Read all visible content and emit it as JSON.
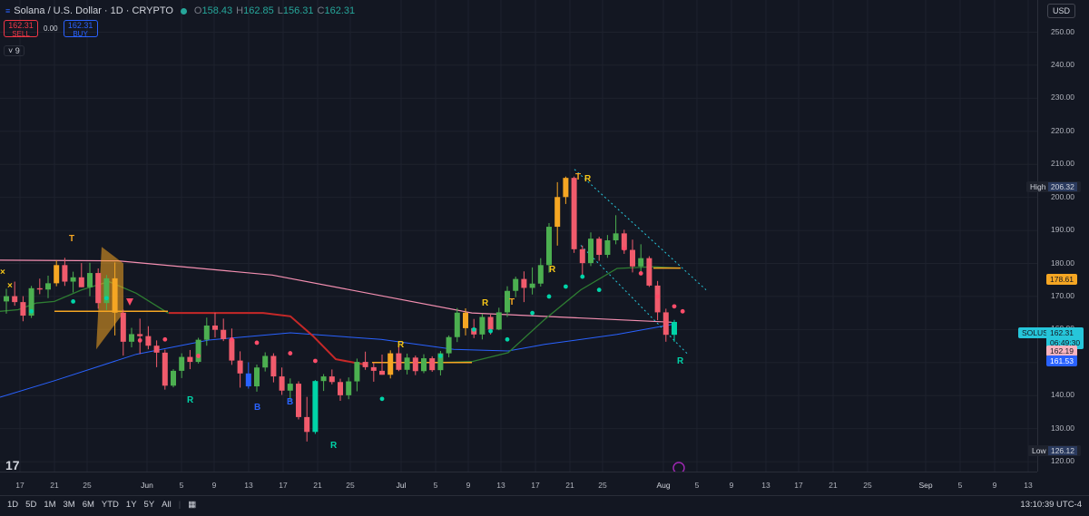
{
  "header": {
    "symbol_title": "Solana / U.S. Dollar · 1D · CRYPTO",
    "ohlc": {
      "o_label": "O",
      "o": "158.43",
      "h_label": "H",
      "h": "162.85",
      "l_label": "L",
      "l": "156.31",
      "c_label": "C",
      "c": "162.31"
    }
  },
  "trade": {
    "sell_price": "162.31",
    "sell_label": "SELL",
    "spread": "0.00",
    "buy_price": "162.31",
    "buy_label": "BUY"
  },
  "indicator_toggle": "˅ 9",
  "currency": "USD",
  "price_scale": [
    "250.00",
    "240.00",
    "230.00",
    "220.00",
    "210.00",
    "200.00",
    "190.00",
    "180.00",
    "170.00",
    "160.00",
    "150.00",
    "140.00",
    "130.00",
    "120.00"
  ],
  "tags": {
    "high_label": "High",
    "high": "206.32",
    "level": "178.61",
    "symbol": "SOLUSD",
    "last": "162.31",
    "countdown": "06:49:30",
    "red_ma": "162.19",
    "blue_ma": "161.53",
    "low_label": "Low",
    "low": "126.12"
  },
  "time_axis": [
    "17",
    "21",
    "25",
    "Jun",
    "5",
    "9",
    "13",
    "17",
    "21",
    "25",
    "Jul",
    "5",
    "9",
    "13",
    "17",
    "21",
    "25",
    "Aug",
    "5",
    "9",
    "13",
    "17",
    "21",
    "25",
    "Sep",
    "5",
    "9",
    "13"
  ],
  "range_buttons": [
    "1D",
    "5D",
    "1M",
    "3M",
    "6M",
    "YTD",
    "1Y",
    "5Y",
    "All"
  ],
  "clock": "13:10:39 UTC-4",
  "logo": "17",
  "chart_data": {
    "type": "candlestick",
    "ylim": [
      117,
      257
    ],
    "colors": {
      "up": "#4caf50",
      "down": "#f15b6c",
      "strong_up": "#00d4a8",
      "strong_down": "#ff4d6a",
      "neutral": "#9e9e6e",
      "signal": "#f5a623",
      "yellow": "#f5c518"
    },
    "candles": [
      [
        168.5,
        172.3,
        164.8,
        170.1
      ],
      [
        170.1,
        174.5,
        167.2,
        168.3
      ],
      [
        168.3,
        170.1,
        162.5,
        164.2
      ],
      [
        164.2,
        173.2,
        163.5,
        172.5
      ],
      [
        172.5,
        175.4,
        170.7,
        172.1
      ],
      [
        172.1,
        176.3,
        169.5,
        174.0
      ],
      [
        174.0,
        181.0,
        173.1,
        179.5
      ],
      [
        179.5,
        181.7,
        173.2,
        174.5
      ],
      [
        174.5,
        177.5,
        171.2,
        175.8
      ],
      [
        175.8,
        180.1,
        172.8,
        172.8
      ],
      [
        172.8,
        180.2,
        170.1,
        177.1
      ],
      [
        177.1,
        178.5,
        166.3,
        168.0
      ],
      [
        168.0,
        176.5,
        165.9,
        175.5
      ],
      [
        175.5,
        180.3,
        158.2,
        165.1
      ],
      [
        165.1,
        166.0,
        152.1,
        156.3
      ],
      [
        156.3,
        160.5,
        154.6,
        158.6
      ],
      [
        158.6,
        163.3,
        152.6,
        158.0
      ],
      [
        158.0,
        161.0,
        154.0,
        155.1
      ],
      [
        155.1,
        156.7,
        148.6,
        153.0
      ],
      [
        153.0,
        153.9,
        141.8,
        143.0
      ],
      [
        143.0,
        148.0,
        142.5,
        147.5
      ],
      [
        147.5,
        152.8,
        145.3,
        151.7
      ],
      [
        151.7,
        153.8,
        148.0,
        150.2
      ],
      [
        150.2,
        157.5,
        149.7,
        156.9
      ],
      [
        156.9,
        163.6,
        155.1,
        161.2
      ],
      [
        161.2,
        165.1,
        157.6,
        159.9
      ],
      [
        159.9,
        163.3,
        156.5,
        157.1
      ],
      [
        157.1,
        160.3,
        149.3,
        150.6
      ],
      [
        150.6,
        153.4,
        142.4,
        146.7
      ],
      [
        146.7,
        150.1,
        142.1,
        142.8
      ],
      [
        142.8,
        149.4,
        141.2,
        148.5
      ],
      [
        148.5,
        153.1,
        147.3,
        152.0
      ],
      [
        152.0,
        152.8,
        144.0,
        145.8
      ],
      [
        145.8,
        148.5,
        140.2,
        141.5
      ],
      [
        141.5,
        145.2,
        138.3,
        143.6
      ],
      [
        143.6,
        144.3,
        132.8,
        133.5
      ],
      [
        133.5,
        139.6,
        126.1,
        129.0
      ],
      [
        129.0,
        144.7,
        128.4,
        144.4
      ],
      [
        144.4,
        146.5,
        141.4,
        145.8
      ],
      [
        145.8,
        147.9,
        143.4,
        144.1
      ],
      [
        144.1,
        145.1,
        138.4,
        140.1
      ],
      [
        140.1,
        145.5,
        138.9,
        144.3
      ],
      [
        144.3,
        151.2,
        141.3,
        150.2
      ],
      [
        150.2,
        153.3,
        147.8,
        148.6
      ],
      [
        148.6,
        149.9,
        144.2,
        147.5
      ],
      [
        147.5,
        152.4,
        146.3,
        146.3
      ],
      [
        146.3,
        153.7,
        145.2,
        152.8
      ],
      [
        152.8,
        155.5,
        147.4,
        147.8
      ],
      [
        147.8,
        152.7,
        146.4,
        151.5
      ],
      [
        151.5,
        152.1,
        146.2,
        147.4
      ],
      [
        147.4,
        152.5,
        146.8,
        151.3
      ],
      [
        151.3,
        151.9,
        147.2,
        147.7
      ],
      [
        147.7,
        153.5,
        146.1,
        152.8
      ],
      [
        152.8,
        158.2,
        151.6,
        157.7
      ],
      [
        157.7,
        166.5,
        156.2,
        165.1
      ],
      [
        165.1,
        166.4,
        158.2,
        160.4
      ],
      [
        160.4,
        163.2,
        157.4,
        158.5
      ],
      [
        158.5,
        164.8,
        157.0,
        163.8
      ],
      [
        163.8,
        164.5,
        158.5,
        160.0
      ],
      [
        160.0,
        166.6,
        159.8,
        165.2
      ],
      [
        165.2,
        173.1,
        163.8,
        171.7
      ],
      [
        171.7,
        176.0,
        169.8,
        175.3
      ],
      [
        175.3,
        177.6,
        168.3,
        172.6
      ],
      [
        172.6,
        178.8,
        170.6,
        173.9
      ],
      [
        173.9,
        181.6,
        173.0,
        179.5
      ],
      [
        179.5,
        192.2,
        177.2,
        191.1
      ],
      [
        191.1,
        204.6,
        185.4,
        200.1
      ],
      [
        200.1,
        206.3,
        198.0,
        205.9
      ],
      [
        205.9,
        206.3,
        183.2,
        184.3
      ],
      [
        184.3,
        185.4,
        176.4,
        180.1
      ],
      [
        180.1,
        189.4,
        179.2,
        187.5
      ],
      [
        187.5,
        188.1,
        180.8,
        182.6
      ],
      [
        182.6,
        188.6,
        181.7,
        187.0
      ],
      [
        187.0,
        194.6,
        185.8,
        189.1
      ],
      [
        189.1,
        190.2,
        182.9,
        184.1
      ],
      [
        184.1,
        187.2,
        177.3,
        179.1
      ],
      [
        179.1,
        185.8,
        177.5,
        181.6
      ],
      [
        181.6,
        182.2,
        172.9,
        173.3
      ],
      [
        173.3,
        174.7,
        162.8,
        165.2
      ],
      [
        165.2,
        166.3,
        156.3,
        158.4
      ],
      [
        158.4,
        162.9,
        156.3,
        162.3
      ]
    ]
  }
}
